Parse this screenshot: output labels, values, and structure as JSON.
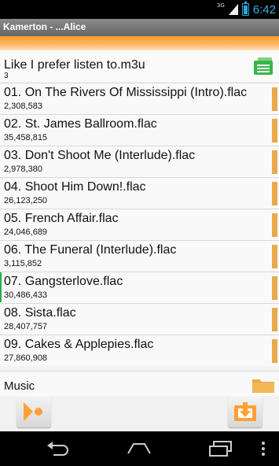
{
  "status_bar": {
    "network": "3G",
    "time": "6:42",
    "icons": [
      "signal-icon",
      "battery-icon"
    ],
    "accent_color": "#33b5e5"
  },
  "titlebar": {
    "title": "Kamerton - ...Alice"
  },
  "playlist": {
    "name": "Like I prefer listen to.m3u",
    "count": "3",
    "icon": "playlist-icon"
  },
  "tracks": [
    {
      "title": "01. On The Rivers Of Mississippi (Intro).flac",
      "size": "2,308,583"
    },
    {
      "title": "02. St. James Ballroom.flac",
      "size": "35,458,815"
    },
    {
      "title": "03. Don't Shoot Me (Interlude).flac",
      "size": "2,978,380"
    },
    {
      "title": "04. Shoot Him Down!.flac",
      "size": "26,123,250"
    },
    {
      "title": "05. French Affair.flac",
      "size": "24,046,689"
    },
    {
      "title": "06. The Funeral (Interlude).flac",
      "size": "3,115,852"
    },
    {
      "title": "07. Gangsterlove.flac",
      "size": "30,486,433"
    },
    {
      "title": "08. Sista.flac",
      "size": "28,407,757"
    },
    {
      "title": "09. Cakes & Applepies.flac",
      "size": "27,860,908"
    }
  ],
  "current_track_index": 6,
  "folder": {
    "name": "Music",
    "icon": "folder-icon"
  },
  "buttons": {
    "left_icon": "play-record-icon",
    "right_icon": "download-folder-icon"
  },
  "nav": {
    "icons": [
      "back-icon",
      "home-icon",
      "recent-apps-icon",
      "menu-icon"
    ]
  },
  "colors": {
    "accent_orange": "#ffa035",
    "track_marker": "#e9a94b",
    "playing_marker": "#22b14c"
  }
}
